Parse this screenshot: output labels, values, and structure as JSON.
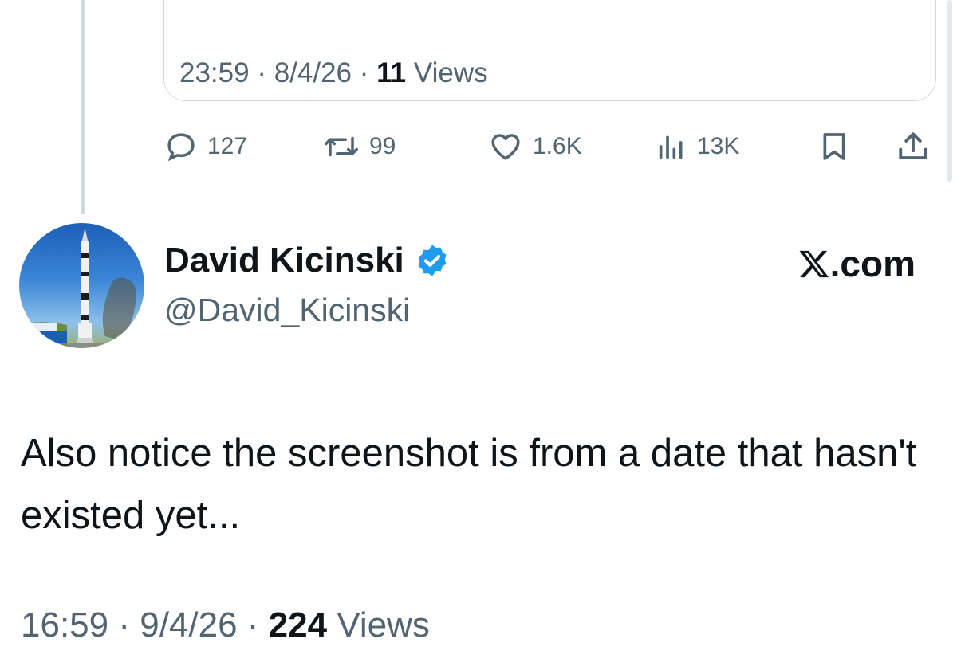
{
  "quoted": {
    "time": "23:59",
    "date": "8/4/26",
    "views_count": "11",
    "views_label": "Views"
  },
  "actions": {
    "replies": "127",
    "reposts": "99",
    "likes": "1.6K",
    "views": "13K"
  },
  "icons": {
    "reply": "speech-bubble-icon",
    "repost": "repost-arrows-icon",
    "like": "heart-icon",
    "views": "bar-chart-icon",
    "bookmark": "bookmark-icon",
    "share": "share-upload-icon",
    "verified": "verified-badge-icon",
    "brand": "x-logo-icon"
  },
  "author": {
    "name": "David Kicinski",
    "handle": "@David_Kicinski",
    "verified": true
  },
  "brand": {
    "label": ".com"
  },
  "tweet": {
    "text": "Also notice the screenshot is from a date that hasn't existed yet...",
    "time": "16:59",
    "date": "9/4/26",
    "views_count": "224",
    "views_label": "Views"
  },
  "colors": {
    "text": "#0f1419",
    "secondary": "#536471",
    "verified": "#1d9bf0",
    "border": "#cfd9de"
  }
}
